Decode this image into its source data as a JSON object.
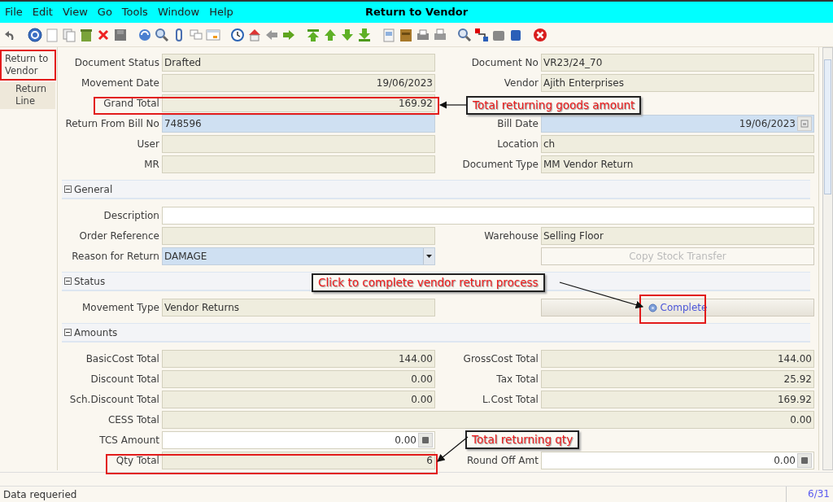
{
  "window": {
    "title": "Return to Vendor"
  },
  "menu": [
    "File",
    "Edit",
    "View",
    "Go",
    "Tools",
    "Window",
    "Help"
  ],
  "side_tabs": [
    {
      "label": "Return to Vendor",
      "selected": true
    },
    {
      "label": "Return Line",
      "selected": false
    }
  ],
  "header_rows": [
    {
      "cells": [
        {
          "kind": "text",
          "readonly": true,
          "label": "Document Status",
          "value": "Drafted"
        },
        {
          "kind": "text",
          "readonly": true,
          "label": "Document No",
          "value": "VR23/24_70"
        }
      ]
    },
    {
      "cells": [
        {
          "kind": "date",
          "readonly": true,
          "label": "Movement Date",
          "value": "19/06/2023"
        },
        {
          "kind": "text",
          "readonly": true,
          "label": "Vendor",
          "value": "Ajith Enterprises"
        }
      ]
    },
    {
      "cells": [
        {
          "kind": "number",
          "readonly": true,
          "label": "Grand Total",
          "value": "169.92"
        }
      ]
    },
    {
      "cells": [
        {
          "kind": "text",
          "readonly": false,
          "mandatory": true,
          "label": "Return From Bill No",
          "value": "748596"
        },
        {
          "kind": "date",
          "readonly": false,
          "mandatory": true,
          "label": "Bill Date",
          "value": "19/06/2023",
          "calendar_button": true
        }
      ]
    },
    {
      "cells": [
        {
          "kind": "text",
          "readonly": true,
          "label": "User"
        },
        {
          "kind": "text",
          "readonly": true,
          "label": "Location",
          "value": "ch"
        }
      ]
    },
    {
      "cells": [
        {
          "kind": "text",
          "readonly": true,
          "label": "MR"
        },
        {
          "kind": "text",
          "readonly": true,
          "label": "Document Type",
          "value": "MM Vendor Return"
        }
      ]
    }
  ],
  "sections": [
    {
      "title": "General",
      "expanded": true,
      "rows": [
        {
          "cells": [
            {
              "kind": "text",
              "readonly": false,
              "mandatory": false,
              "label": "Description",
              "wide": true
            }
          ]
        },
        {
          "cells": [
            {
              "kind": "text",
              "readonly": true,
              "label": "Order Reference"
            },
            {
              "kind": "text",
              "readonly": true,
              "label": "Warehouse",
              "value": "Selling Floor"
            }
          ]
        },
        {
          "cells": [
            {
              "kind": "combo",
              "readonly": false,
              "mandatory": true,
              "label": "Reason for Return",
              "value": "DAMAGE"
            },
            {
              "kind": "button",
              "label": "Copy Stock Transfer",
              "disabled": true,
              "has_icon": false
            }
          ]
        }
      ]
    },
    {
      "title": "Status",
      "expanded": true,
      "rows": [
        {
          "cells": [
            {
              "kind": "text",
              "readonly": true,
              "label": "Movement Type",
              "value": "Vendor Returns"
            },
            {
              "kind": "button",
              "label": "Complete",
              "disabled": false,
              "has_icon": true
            }
          ]
        }
      ]
    },
    {
      "title": "Amounts",
      "expanded": true,
      "rows": [
        {
          "cells": [
            {
              "kind": "number",
              "readonly": true,
              "label": "BasicCost Total",
              "value": "144.00"
            },
            {
              "kind": "number",
              "readonly": true,
              "label": "GrossCost Total",
              "value": "144.00"
            }
          ]
        },
        {
          "cells": [
            {
              "kind": "number",
              "readonly": true,
              "label": "Discount Total",
              "value": "0.00"
            },
            {
              "kind": "number",
              "readonly": true,
              "label": "Tax Total",
              "value": "25.92"
            }
          ]
        },
        {
          "cells": [
            {
              "kind": "number",
              "readonly": true,
              "label": "Sch.Discount Total",
              "value": "0.00"
            },
            {
              "kind": "number",
              "readonly": true,
              "label": "L.Cost Total",
              "value": "169.92"
            }
          ]
        },
        {
          "cells": [
            {
              "kind": "number",
              "readonly": true,
              "label": "CESS Total",
              "value": "0.00",
              "wide": true
            }
          ]
        },
        {
          "cells": [
            {
              "kind": "number",
              "readonly": false,
              "mandatory": false,
              "label": "TCS Amount",
              "value": "0.00",
              "calculator_button": true
            }
          ]
        },
        {
          "cells": [
            {
              "kind": "number",
              "readonly": true,
              "label": "Qty Total",
              "value": "6"
            },
            {
              "kind": "number",
              "readonly": false,
              "mandatory": false,
              "label": "Round Off Amt",
              "value": "0.00",
              "calculator_button": true
            }
          ]
        }
      ]
    }
  ],
  "annotations": [
    {
      "text": "Total returning goods amount"
    },
    {
      "text": "Click to complete vendor return process"
    },
    {
      "text": "Total returning qty"
    }
  ],
  "status_bar": {
    "message": "Data requeried",
    "record": "6/31"
  }
}
